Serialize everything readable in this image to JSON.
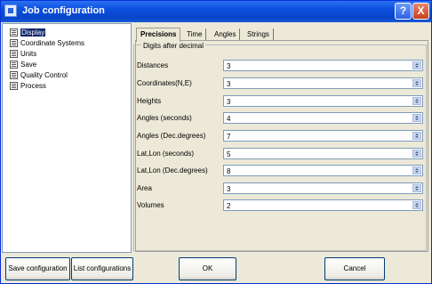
{
  "window": {
    "title": "Job configuration",
    "help_label": "?",
    "close_label": "X"
  },
  "tree": {
    "items": [
      {
        "label": "Display",
        "selected": true
      },
      {
        "label": "Coordinate Systems"
      },
      {
        "label": "Units"
      },
      {
        "label": "Save"
      },
      {
        "label": "Quality Control"
      },
      {
        "label": "Process"
      }
    ]
  },
  "tabs": [
    {
      "label": "Precisions",
      "active": true
    },
    {
      "label": "Time"
    },
    {
      "label": "Angles"
    },
    {
      "label": "Strings"
    }
  ],
  "group": {
    "legend": "Digits after decimal"
  },
  "fields": [
    {
      "label": "Distances",
      "value": "3"
    },
    {
      "label": "Coordinates(N,E)",
      "value": "3"
    },
    {
      "label": "Heights",
      "value": "3"
    },
    {
      "label": "Angles (seconds)",
      "value": "4"
    },
    {
      "label": "Angles (Dec.degrees)",
      "value": "7"
    },
    {
      "label": "Lat,Lon (seconds)",
      "value": "5"
    },
    {
      "label": "Lat,Lon (Dec.degrees)",
      "value": "8"
    },
    {
      "label": "Area",
      "value": "3"
    },
    {
      "label": "Volumes",
      "value": "2"
    }
  ],
  "buttons": {
    "save": "Save configuration",
    "list": "List configurations",
    "ok": "OK",
    "cancel": "Cancel"
  }
}
